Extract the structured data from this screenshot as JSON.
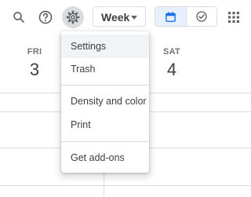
{
  "toolbar": {
    "search_icon": "search-icon",
    "help_icon": "help-icon",
    "settings_icon": "gear-icon",
    "view_select": {
      "selected": "Week"
    },
    "view_toggle": {
      "calendar_icon": "calendar-icon",
      "tasks_icon": "check-circle-icon",
      "selected": "calendar"
    },
    "apps_icon": "apps-grid-icon"
  },
  "calendar": {
    "days": [
      {
        "name": "FRI",
        "number": "3"
      },
      {
        "name": "SAT",
        "number": "4"
      }
    ]
  },
  "settings_menu": {
    "items": [
      {
        "label": "Settings",
        "highlighted": true
      },
      {
        "label": "Trash"
      },
      {
        "label": "Density and color"
      },
      {
        "label": "Print"
      },
      {
        "label": "Get add-ons"
      }
    ]
  },
  "colors": {
    "accent": "#1a73e8",
    "toggle_selected_bg": "#e8f0fe",
    "divider": "#dadce0",
    "text": "#3c4043",
    "muted": "#70757a"
  }
}
